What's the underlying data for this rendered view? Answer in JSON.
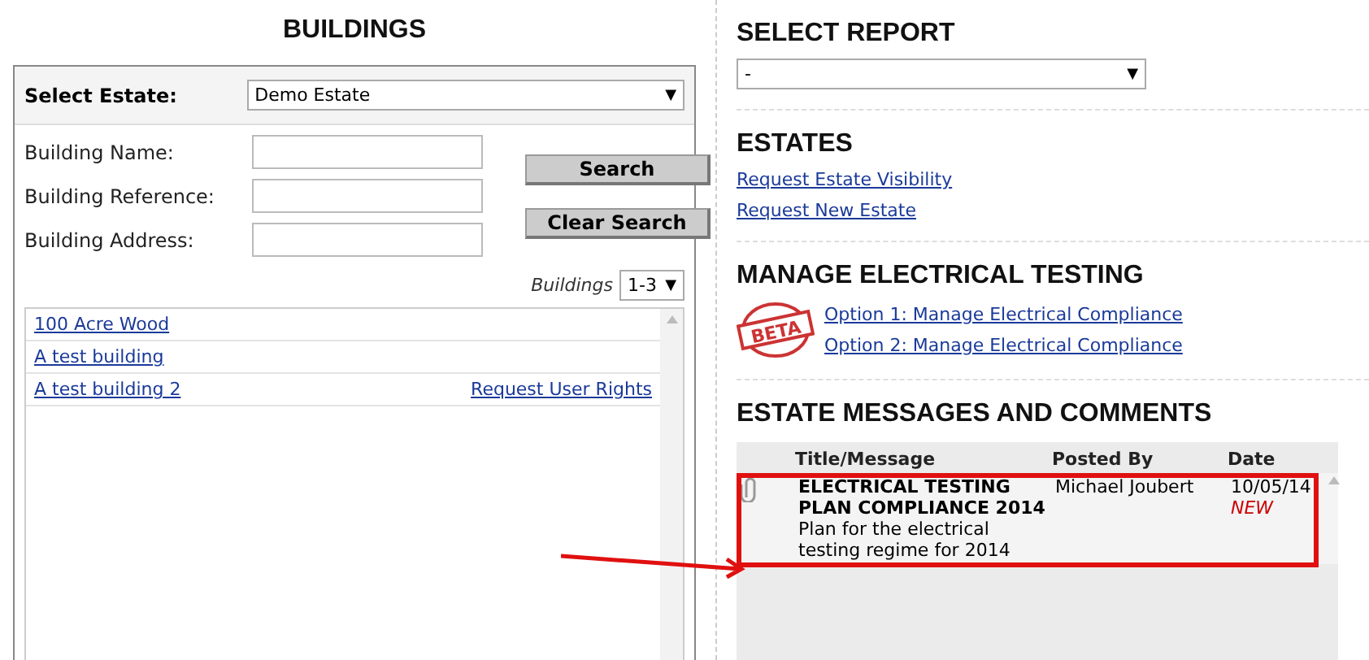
{
  "buildings": {
    "title": "BUILDINGS",
    "estate": {
      "label": "Select Estate:",
      "value": "Demo Estate",
      "caret": "▼"
    },
    "fields": [
      {
        "label": "Building Name:"
      },
      {
        "label": "Building Reference:"
      },
      {
        "label": "Building Address:"
      }
    ],
    "buttons": [
      "Search",
      "Clear Search"
    ],
    "pager": {
      "label": "Buildings",
      "value": "1-3",
      "caret": "▼"
    },
    "list": [
      {
        "name": "100 Acre Wood"
      },
      {
        "name": "A test building"
      },
      {
        "name": "A test building 2",
        "action": "Request User Rights"
      }
    ]
  },
  "report": {
    "title": "SELECT REPORT",
    "value": "-",
    "caret": "▼"
  },
  "estates": {
    "title": "ESTATES",
    "links": [
      "Request Estate Visibility",
      "Request New Estate"
    ]
  },
  "electrical": {
    "title": "MANAGE ELECTRICAL TESTING",
    "badge": "BETA",
    "links": [
      "Option 1: Manage Electrical Compliance",
      "Option 2: Manage Electrical Compliance"
    ]
  },
  "messages": {
    "title": "ESTATE MESSAGES AND COMMENTS",
    "columns": [
      "Title/Message",
      "Posted By",
      "Date"
    ],
    "rows": [
      {
        "title": "ELECTRICAL TESTING PLAN COMPLIANCE 2014",
        "message": "Plan for the electrical testing regime for 2014",
        "posted_by": "Michael Joubert",
        "date": "10/05/14",
        "tag": "NEW",
        "attachment": true,
        "highlighted": true
      }
    ]
  }
}
